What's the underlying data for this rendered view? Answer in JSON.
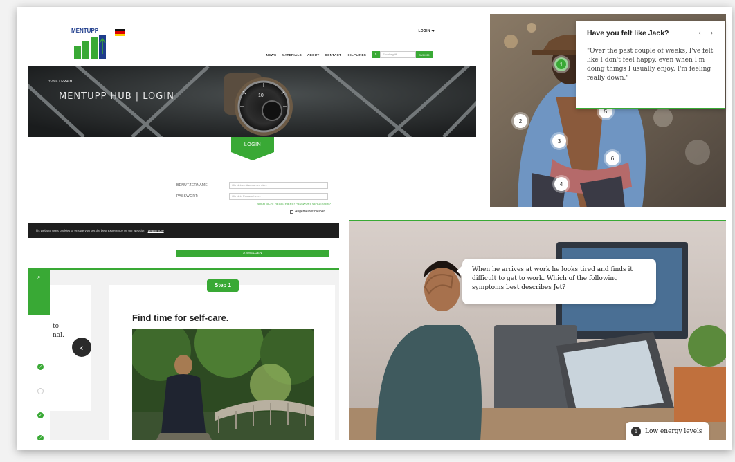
{
  "login_page": {
    "logo_text_a": "MENTUPP",
    "login_link": "LOGIN",
    "nav": [
      "NEWS",
      "MATERIALS",
      "ABOUT",
      "CONTACT",
      "HELPLINES"
    ],
    "search_placeholder": "Suchbegriff...",
    "search_button": "SUCHEN",
    "breadcrumb_home": "HOME /",
    "breadcrumb_current": "LOGIN",
    "hero_title": "MENTUPP HUB | LOGIN",
    "login_badge": "LOGIN",
    "username_label": "BENUTZERNAME:",
    "username_placeholder": "Gib deinen Usernamen ein...",
    "password_label": "PASSWORT:",
    "password_placeholder": "Gib dein Passwort ein...",
    "form_links": "NOCH NICHT REGISTRIERT? PASSWORT VERGESSEN?",
    "remember": "Angemeldet bleiben",
    "cookie_text": "This website uses cookies to ensure you get the best experience on our website.",
    "cookie_link": "Learn more",
    "submit": "ANMELDEN"
  },
  "jack_panel": {
    "title": "Have you felt like Jack?",
    "arrows": "‹ ›",
    "quote": "\"Over the past couple of weeks, I've felt like I don't feel happy, even when I'm doing things I usually enjoy. I'm feeling really down.\"",
    "hotspots": [
      "1",
      "2",
      "3",
      "4",
      "5",
      "6"
    ]
  },
  "selfcare_panel": {
    "left_text_line1": "to",
    "left_text_line2": "nal.",
    "step_label": "Step 1",
    "title": "Find time for self-care."
  },
  "jet_panel": {
    "bubble": "When he arrives at work he looks tired and finds it difficult to get to work. Which of the following symptoms best describes Jet?",
    "answer_number": "1",
    "answer_label": "Low energy levels"
  },
  "colors": {
    "accent_green": "#39a935",
    "logo_blue": "#1e3c8c",
    "dark": "#1e1e1e"
  }
}
